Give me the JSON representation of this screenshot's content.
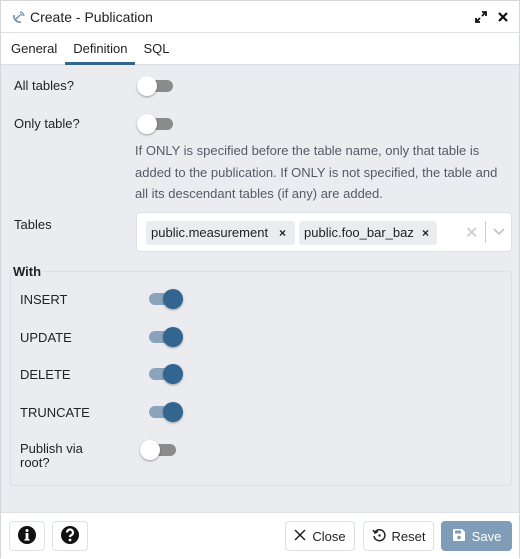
{
  "window": {
    "title": "Create - Publication",
    "icons": {
      "app": "publication-icon",
      "maximize": "maximize-icon",
      "close": "close-icon"
    }
  },
  "tabs": [
    {
      "label": "General",
      "active": false
    },
    {
      "label": "Definition",
      "active": true
    },
    {
      "label": "SQL",
      "active": false
    }
  ],
  "form": {
    "all_tables": {
      "label": "All tables?",
      "value": false
    },
    "only_table": {
      "label": "Only table?",
      "value": false,
      "help": "If ONLY is specified before the table name, only that table is added to the publication. If ONLY is not specified, the table and all its descendant tables (if any) are added."
    },
    "tables": {
      "label": "Tables",
      "selected": [
        "public.measurement",
        "public.foo_bar_baz"
      ],
      "remove_glyph": "×",
      "clear_glyph": "✕"
    },
    "with": {
      "legend": "With",
      "options": [
        {
          "label": "INSERT",
          "value": true
        },
        {
          "label": "UPDATE",
          "value": true
        },
        {
          "label": "DELETE",
          "value": true
        },
        {
          "label": "TRUNCATE",
          "value": true
        }
      ],
      "publish_via_root": {
        "label": "Publish via root?",
        "value": false
      }
    }
  },
  "footer": {
    "info_icon": "info-icon",
    "help_icon": "help-icon",
    "close_label": "Close",
    "reset_label": "Reset",
    "save_label": "Save"
  },
  "colors": {
    "accent": "#326690",
    "save_bg": "#7f9cb9",
    "panel_bg": "#ebecf0"
  }
}
